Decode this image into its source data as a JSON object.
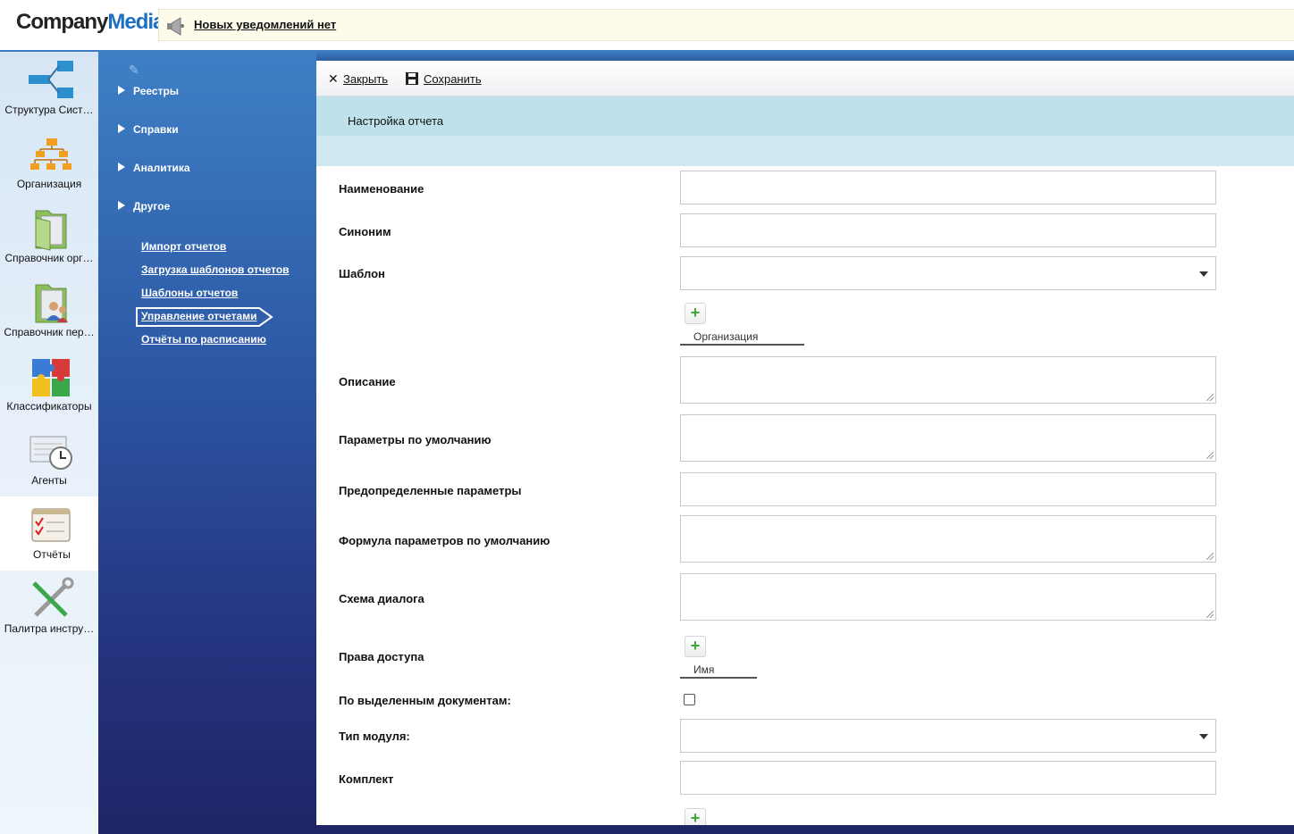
{
  "app": {
    "logo_company": "Company",
    "logo_media": "Media"
  },
  "notification": {
    "text": "Новых уведомлений нет",
    "icon": "megaphone-icon"
  },
  "iconbar": {
    "items": [
      {
        "label": "Структура Сист…",
        "icon": "structure-icon"
      },
      {
        "label": "Организация",
        "icon": "organization-icon"
      },
      {
        "label": "Справочник орг…",
        "icon": "folder-icon"
      },
      {
        "label": "Справочник пер…",
        "icon": "folder-users-icon"
      },
      {
        "label": "Классификаторы",
        "icon": "puzzle-icon"
      },
      {
        "label": "Агенты",
        "icon": "clock-icon"
      },
      {
        "label": "Отчёты",
        "icon": "report-checklist-icon"
      },
      {
        "label": "Палитра инстру…",
        "icon": "tools-icon"
      }
    ],
    "active_index": 6
  },
  "nav": {
    "sections": [
      "Реестры",
      "Справки",
      "Аналитика",
      "Другое"
    ],
    "links": [
      "Импорт отчетов",
      "Загрузка шаблонов отчетов",
      "Шаблоны отчетов",
      "Управление отчетами",
      "Отчёты по расписанию"
    ],
    "active_link": "Управление отчетами"
  },
  "toolbar": {
    "close_label": "Закрыть",
    "save_label": "Сохранить"
  },
  "page": {
    "title": "Настройка отчета"
  },
  "form": {
    "name_label": "Наименование",
    "synonym_label": "Синоним",
    "template_label": "Шаблон",
    "org_column": "Организация",
    "description_label": "Описание",
    "default_params_label": "Параметры по умолчанию",
    "predefined_params_label": "Предопределенные параметры",
    "formula_label": "Формула параметров по умолчанию",
    "dialog_schema_label": "Схема диалога",
    "access_label": "Права доступа",
    "access_column": "Имя",
    "selected_docs_label": "По выделенным документам:",
    "module_type_label": "Тип модуля:",
    "kit_label": "Комплект"
  }
}
